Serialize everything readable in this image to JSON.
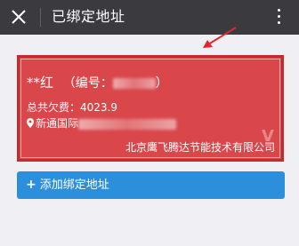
{
  "header": {
    "title": "已绑定地址",
    "close_icon": "close-icon",
    "more_icon": "more-vertical-icon"
  },
  "card": {
    "name": "**红",
    "id_prefix": "（编号：",
    "id_suffix": "）",
    "amount_label": "总共欠费：",
    "amount_value": "4023.9",
    "address": "新通国际",
    "company": "北京鹰飞腾达节能技术有限公司",
    "watermark": "V",
    "colors": {
      "fill": "#d9474b",
      "border": "#c42a2e"
    }
  },
  "actions": {
    "add_address_label": "添加绑定地址",
    "add_icon": "plus-icon",
    "color": "#2c8fdb"
  },
  "theme": {
    "nav_bg": "#3a3a3f",
    "page_bg": "#efeff4",
    "annotation_color": "#e0282e"
  }
}
